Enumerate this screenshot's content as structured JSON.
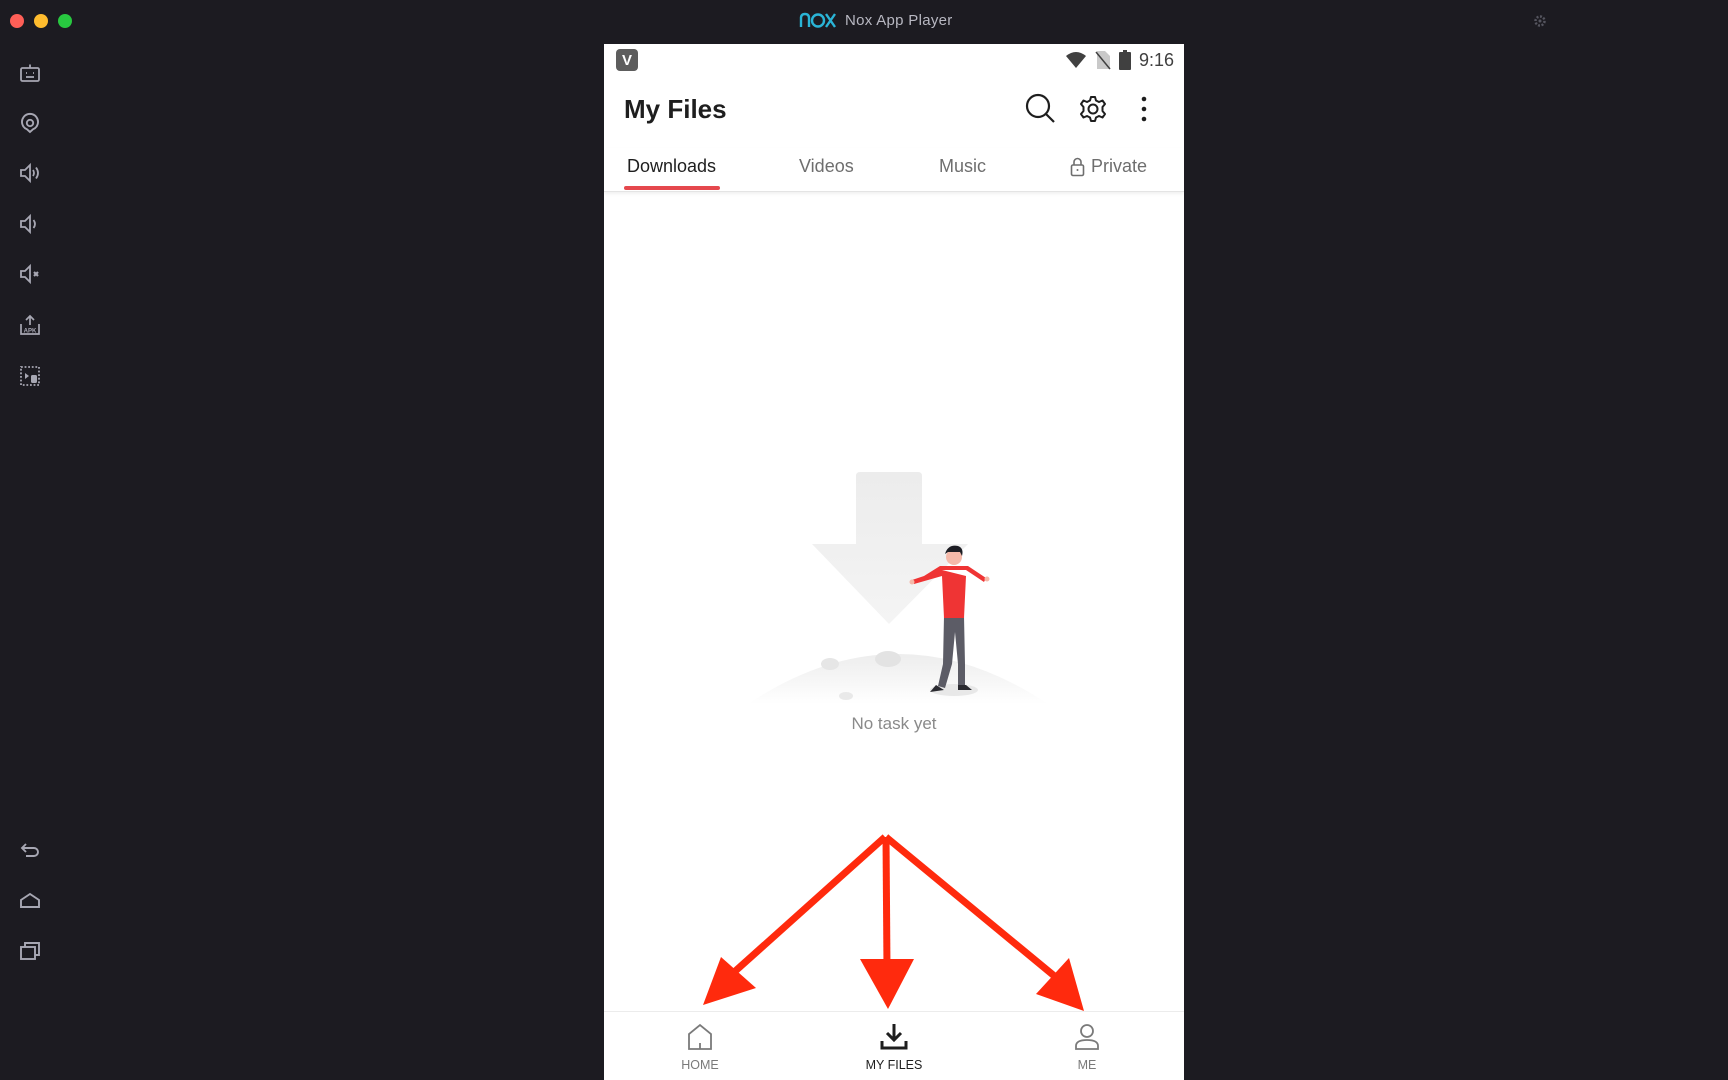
{
  "window": {
    "title": "Nox App Player",
    "logo_text": "nox"
  },
  "sidebar": {
    "top_items": [
      {
        "name": "keyboard-mapping",
        "icon": "robot-keyboard-icon"
      },
      {
        "name": "location",
        "icon": "location-pin-icon"
      },
      {
        "name": "volume-up",
        "icon": "volume-up-icon"
      },
      {
        "name": "volume-down",
        "icon": "volume-down-icon"
      },
      {
        "name": "mute",
        "icon": "volume-mute-icon"
      },
      {
        "name": "install-apk",
        "icon": "apk-upload-icon"
      },
      {
        "name": "screen-record",
        "icon": "screen-record-icon"
      }
    ],
    "bottom_items": [
      {
        "name": "back",
        "icon": "back-arrow-icon"
      },
      {
        "name": "home",
        "icon": "home-icon"
      },
      {
        "name": "recent-apps",
        "icon": "recent-apps-icon"
      }
    ]
  },
  "status_bar": {
    "time": "9:16",
    "app_icon_letter": "V"
  },
  "header": {
    "title": "My Files"
  },
  "tabs": [
    {
      "label": "Downloads",
      "active": true
    },
    {
      "label": "Videos",
      "active": false
    },
    {
      "label": "Music",
      "active": false
    },
    {
      "label": "Private",
      "active": false,
      "icon": "lock-icon"
    }
  ],
  "empty_state": {
    "message": "No task yet"
  },
  "bottom_nav": [
    {
      "label": "HOME",
      "icon": "home-outline-icon",
      "active": false
    },
    {
      "label": "MY FILES",
      "icon": "download-tray-icon",
      "active": true
    },
    {
      "label": "ME",
      "icon": "person-icon",
      "active": false
    }
  ],
  "colors": {
    "accent": "#e5484d",
    "annotation_arrow": "#ff2a0d",
    "emulator_bg": "#1c1b21",
    "nox_logo": "#2ab4d6"
  }
}
